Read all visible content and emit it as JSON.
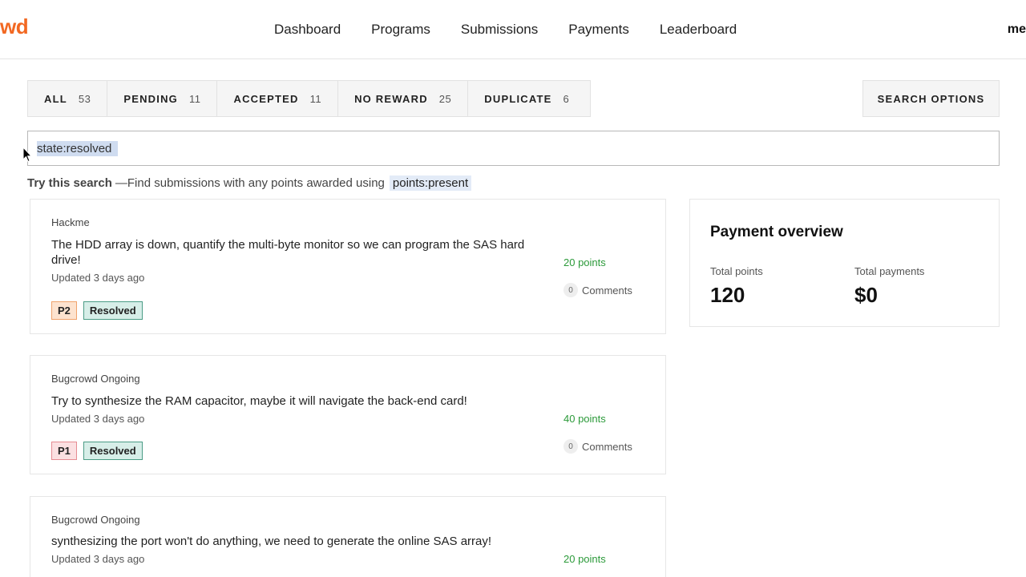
{
  "header": {
    "logo_text": "wd",
    "nav": [
      "Dashboard",
      "Programs",
      "Submissions",
      "Payments",
      "Leaderboard"
    ],
    "user": "me"
  },
  "filters": [
    {
      "label": "ALL",
      "count": "53"
    },
    {
      "label": "PENDING",
      "count": "11"
    },
    {
      "label": "ACCEPTED",
      "count": "11"
    },
    {
      "label": "NO REWARD",
      "count": "25"
    },
    {
      "label": "DUPLICATE",
      "count": "6"
    }
  ],
  "search": {
    "options_label": "SEARCH OPTIONS",
    "value": "state:resolved",
    "hint_bold": "Try this search",
    "hint_text": "—Find submissions with any points awarded using",
    "hint_code": "points:present"
  },
  "submissions": [
    {
      "program": "Hackme",
      "title": "The HDD array is down, quantify the multi-byte monitor so we can program the SAS hard drive!",
      "updated": "Updated 3 days ago",
      "points": "20 points",
      "comments_count": "0",
      "comments_label": "Comments",
      "priority": "P2",
      "status": "Resolved"
    },
    {
      "program": "Bugcrowd Ongoing",
      "title": "Try to synthesize the RAM capacitor, maybe it will navigate the back-end card!",
      "updated": "Updated 3 days ago",
      "points": "40 points",
      "comments_count": "0",
      "comments_label": "Comments",
      "priority": "P1",
      "status": "Resolved"
    },
    {
      "program": "Bugcrowd Ongoing",
      "title": "synthesizing the port won't do anything, we need to generate the online SAS array!",
      "updated": "Updated 3 days ago",
      "points": "20 points"
    }
  ],
  "payment_overview": {
    "title": "Payment overview",
    "total_points_label": "Total points",
    "total_points": "120",
    "total_payments_label": "Total payments",
    "total_payments": "$0"
  },
  "colors": {
    "brand": "#f26822",
    "points_green": "#2c9a3a",
    "resolved_bg": "#d7eee8",
    "p1_bg": "#fbe0e2",
    "p2_bg": "#fde3cf"
  }
}
